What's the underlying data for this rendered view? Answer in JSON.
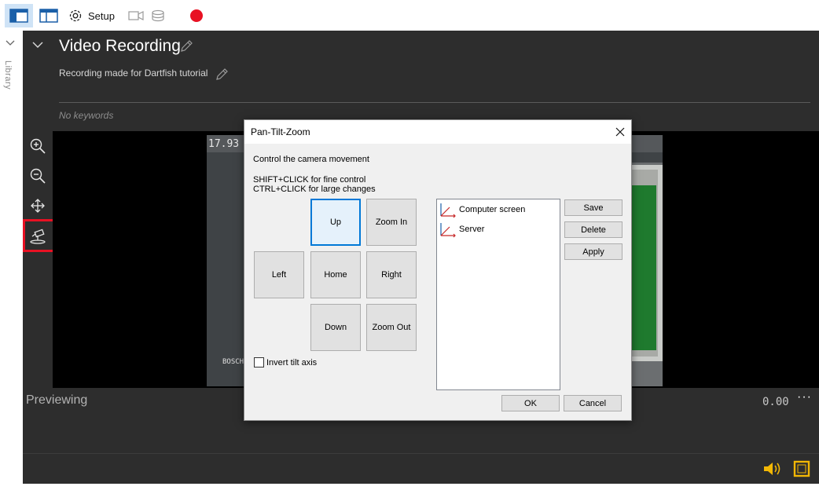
{
  "toolbar": {
    "setup_label": "Setup",
    "icons": [
      "layout-panels-icon",
      "layout-window-icon",
      "gear-icon",
      "camera-icon",
      "database-icon",
      "record-icon"
    ],
    "record_color": "#e81123",
    "active_bg": "#cfe3f6"
  },
  "library": {
    "label": "Library"
  },
  "recording": {
    "title": "Video Recording",
    "description": "Recording made for Dartfish tutorial",
    "keywords_placeholder": "No keywords"
  },
  "tools": [
    "zoom-in-icon",
    "zoom-out-icon",
    "move-icon",
    "ptz-camera-icon"
  ],
  "video": {
    "timestamp": "17.93",
    "overlay_brand": "BOSCH"
  },
  "playback": {
    "status": "Previewing",
    "timecode": "0.00",
    "more": "···"
  },
  "ptz_dialog": {
    "title": "Pan-Tilt-Zoom",
    "instruction": "Control the camera movement",
    "hint_shift": "SHIFT+CLICK for fine control",
    "hint_ctrl": "CTRL+CLICK for large changes",
    "buttons": {
      "up": "Up",
      "zoom_in": "Zoom In",
      "left": "Left",
      "home": "Home",
      "right": "Right",
      "down": "Down",
      "zoom_out": "Zoom Out"
    },
    "invert_tilt_label": "Invert tilt axis",
    "invert_tilt_checked": false,
    "presets": [
      "Computer screen",
      "Server"
    ],
    "save_label": "Save",
    "delete_label": "Delete",
    "apply_label": "Apply",
    "ok_label": "OK",
    "cancel_label": "Cancel"
  },
  "colors": {
    "panel_dark": "#2d2d2d",
    "highlight_red": "#e81123",
    "accent_blue": "#0078d7",
    "speaker_yellow": "#f2b705"
  }
}
